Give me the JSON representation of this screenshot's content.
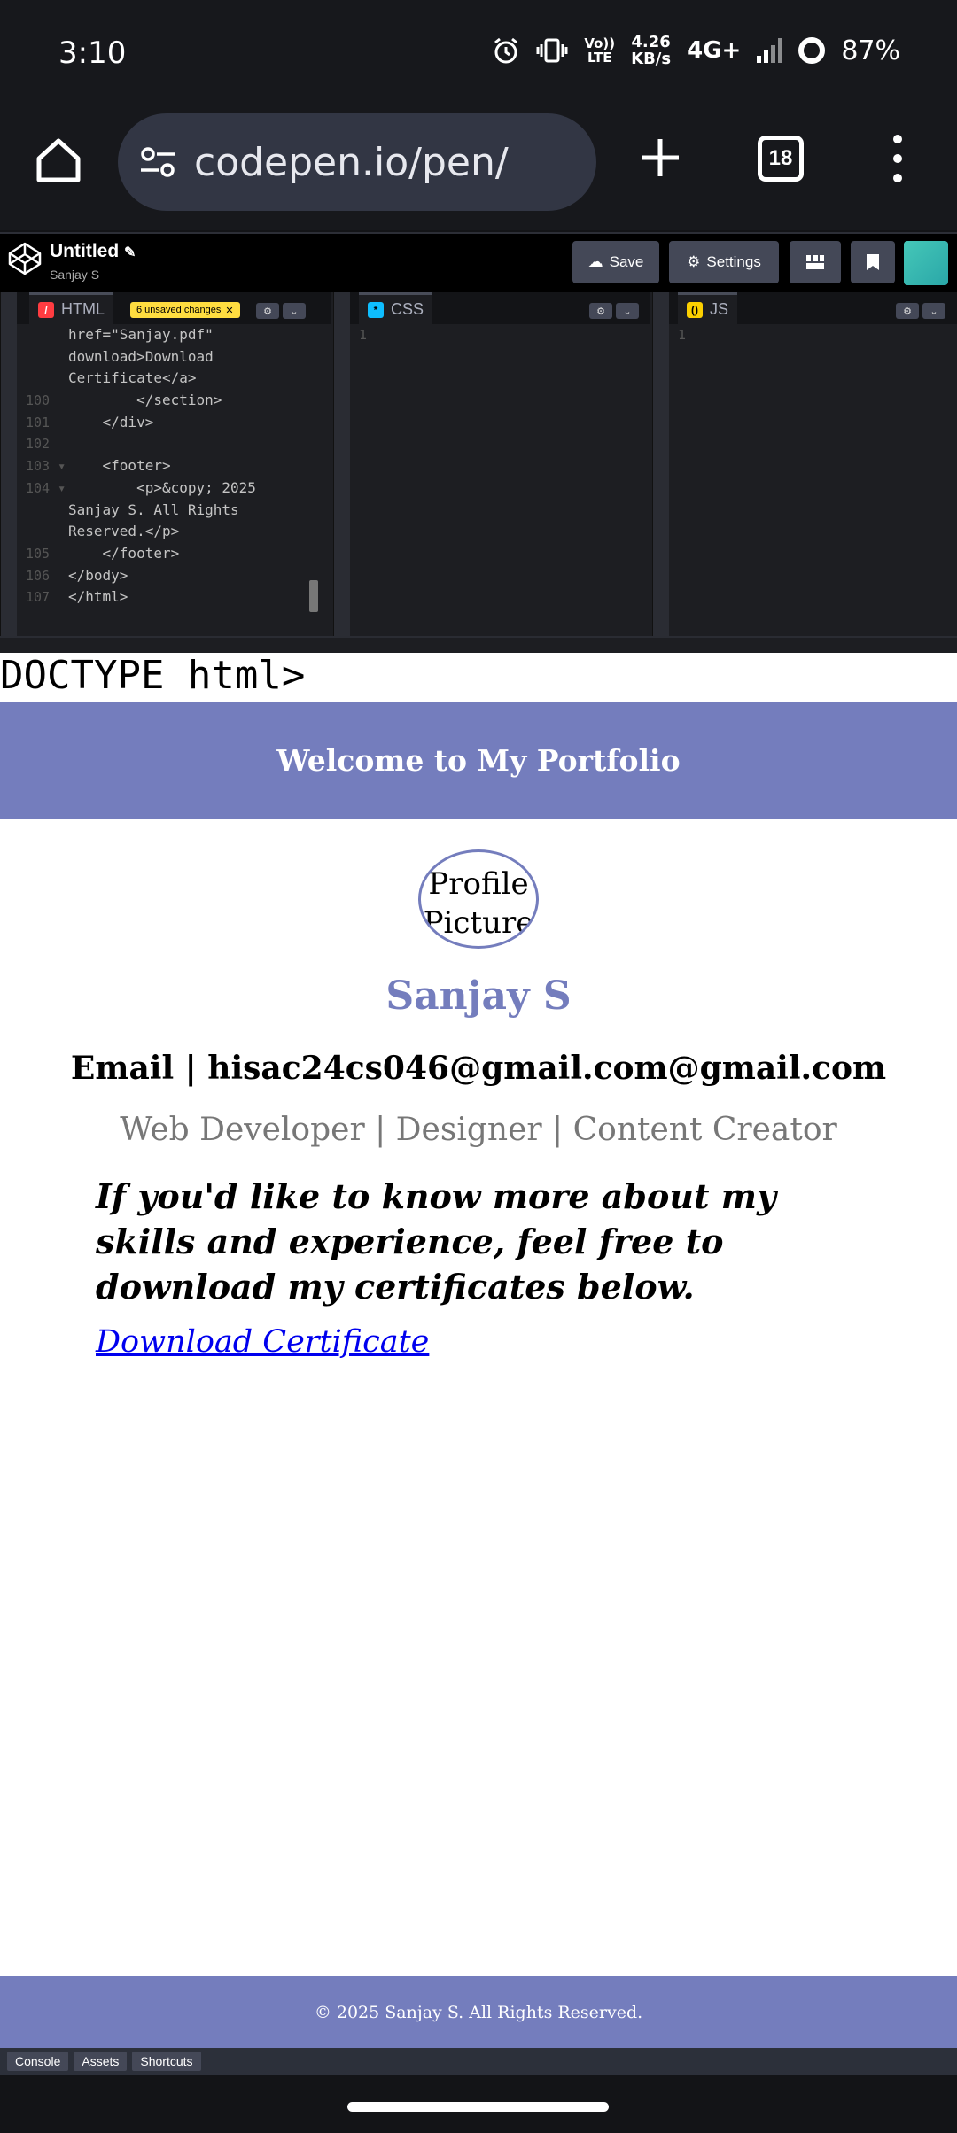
{
  "status_bar": {
    "time": "3:10",
    "volte_top": "Vo))",
    "volte_bottom": "LTE",
    "net_speed_value": "4.26",
    "net_speed_unit": "KB/s",
    "network": "4G+",
    "battery": "87%"
  },
  "browser": {
    "url": "codepen.io/pen/",
    "tab_count": "18"
  },
  "codepen": {
    "title": "Untitled",
    "author": "Sanjay S",
    "save_label": "Save",
    "settings_label": "Settings",
    "unsaved_badge": "6 unsaved changes"
  },
  "editors": {
    "html_tab": "HTML",
    "css_tab": "CSS",
    "js_tab": "JS",
    "css_line_no": "1",
    "js_line_no": "1",
    "html_lines": [
      {
        "ln": "",
        "code": "href=\"Sanjay.pdf\""
      },
      {
        "ln": "",
        "code": "download>Download"
      },
      {
        "ln": "",
        "code": "Certificate</a>"
      },
      {
        "ln": "100",
        "code": "        </section>"
      },
      {
        "ln": "101",
        "code": "    </div>"
      },
      {
        "ln": "102",
        "code": ""
      },
      {
        "ln": "103 ▾",
        "code": "    <footer>"
      },
      {
        "ln": "104 ▾",
        "code": "        <p>&copy; 2025"
      },
      {
        "ln": "",
        "code": "Sanjay S. All Rights"
      },
      {
        "ln": "",
        "code": "Reserved.</p>"
      },
      {
        "ln": "105",
        "code": "    </footer>"
      },
      {
        "ln": "106",
        "code": "</body>"
      },
      {
        "ln": "107",
        "code": "</html>"
      }
    ]
  },
  "preview": {
    "doctype": "DOCTYPE html>",
    "header": "Welcome to My Portfolio",
    "profile_text": "Profile Picture",
    "name": "Sanjay S",
    "email": "Email | hisac24cs046@gmail.com@gmail.com",
    "role": "Web Developer | Designer | Content Creator",
    "paragraph": "If you'd like to know more about my skills and experience, feel free to download my certificates below.",
    "link": "Download Certificate",
    "footer": "© 2025 Sanjay S. All Rights Reserved."
  },
  "bottom_bar": {
    "console": "Console",
    "assets": "Assets",
    "shortcuts": "Shortcuts"
  },
  "colors": {
    "accent": "#747dbd",
    "link": "#0000ee",
    "unsaved": "#ffdd40"
  }
}
